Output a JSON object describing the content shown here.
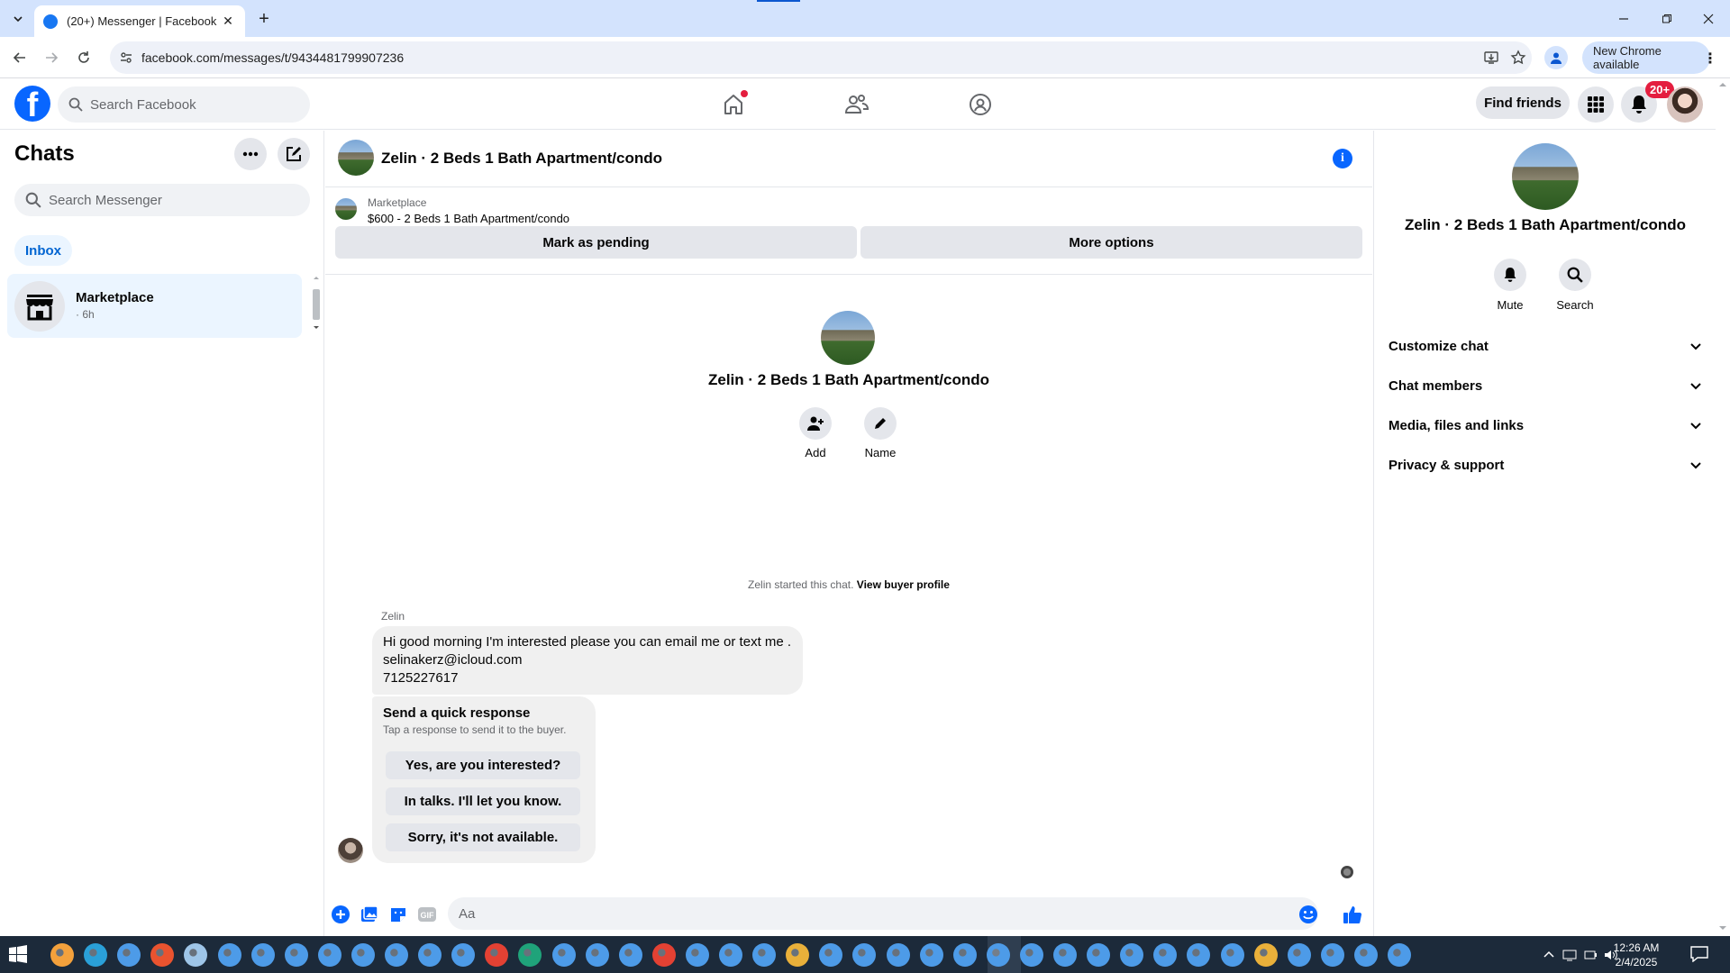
{
  "browser": {
    "tab_title": "(20+) Messenger | Facebook",
    "url": "facebook.com/messages/t/9434481799907236",
    "update_label": "New Chrome available"
  },
  "fb_header": {
    "search_placeholder": "Search Facebook",
    "find_friends": "Find friends",
    "notif_count": "20+",
    "brand_color": "#0866ff"
  },
  "sidebar": {
    "title": "Chats",
    "search_placeholder": "Search Messenger",
    "filter": "Inbox",
    "chats": [
      {
        "name": "Marketplace",
        "time": "· 6h"
      }
    ]
  },
  "conversation": {
    "title": "Zelin · 2 Beds 1 Bath Apartment/condo",
    "marketplace_label": "Marketplace",
    "listing": "$600 - 2 Beds 1 Bath Apartment/condo",
    "mark_pending": "Mark as pending",
    "more_options": "More options",
    "actions": [
      {
        "label": "Add",
        "icon": "add-person-icon"
      },
      {
        "label": "Name",
        "icon": "pencil-icon"
      }
    ],
    "started_text": "Zelin started this chat.",
    "view_profile": "View buyer profile",
    "sender": "Zelin",
    "message_lines": [
      "Hi good morning I'm interested please you can email me or text me .",
      "selinakerz@icloud.com",
      "7125227617"
    ],
    "quick_response": {
      "heading": "Send a quick response",
      "subheading": "Tap a response to send it to the buyer.",
      "options": [
        "Yes, are you interested?",
        "In talks. I'll let you know.",
        "Sorry, it's not available."
      ]
    },
    "composer_placeholder": "Aa"
  },
  "details": {
    "title": "Zelin · 2 Beds 1 Bath Apartment/condo",
    "actions": [
      {
        "label": "Mute",
        "icon": "bell-icon"
      },
      {
        "label": "Search",
        "icon": "search-icon"
      }
    ],
    "sections": [
      "Customize chat",
      "Chat members",
      "Media, files and links",
      "Privacy & support"
    ]
  },
  "taskbar": {
    "time": "12:26 AM",
    "date": "2/4/2025"
  }
}
